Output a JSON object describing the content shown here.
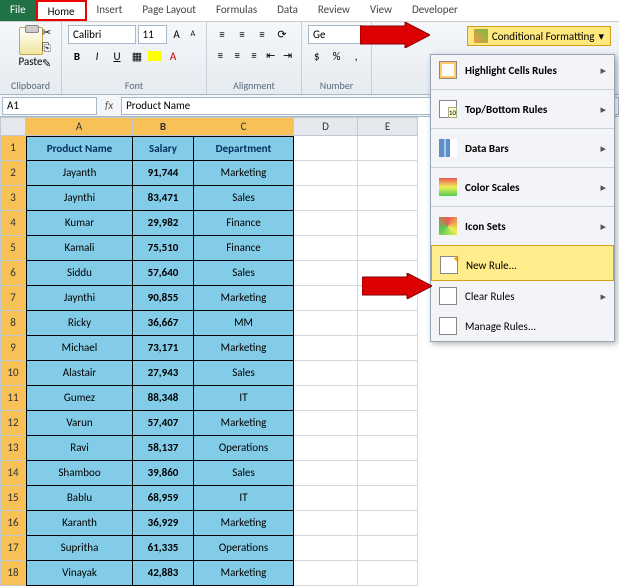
{
  "tabs": {
    "file": "File",
    "home": "Home",
    "insert": "Insert",
    "pagelayout": "Page Layout",
    "formulas": "Formulas",
    "data": "Data",
    "review": "Review",
    "view": "View",
    "developer": "Developer"
  },
  "ribbon": {
    "paste": "Paste",
    "clipboard_label": "Clipboard",
    "font_name": "Calibri",
    "font_size": "11",
    "font_label": "Font",
    "align_label": "Alignment",
    "num_format": "Ge",
    "number_label": "Number",
    "cf_label": "Conditional Formatting"
  },
  "namebox": "A1",
  "fx": "fx",
  "formula": "Product Name",
  "cols": {
    "a": "A",
    "b": "B",
    "c": "C",
    "d": "D",
    "e": "E"
  },
  "headerRow": {
    "a": "Product Name",
    "b": "Salary",
    "c": "Department"
  },
  "chart_data": {
    "type": "table",
    "columns": [
      "Product Name",
      "Salary",
      "Department"
    ],
    "rows": [
      [
        "Jayanth",
        "91,744",
        "Marketing"
      ],
      [
        "Jaynthi",
        "83,471",
        "Sales"
      ],
      [
        "Kumar",
        "29,982",
        "Finance"
      ],
      [
        "Kamali",
        "75,510",
        "Finance"
      ],
      [
        "Siddu",
        "57,640",
        "Sales"
      ],
      [
        "Jaynthi",
        "90,855",
        "Marketing"
      ],
      [
        "Ricky",
        "36,667",
        "MM"
      ],
      [
        "Michael",
        "73,171",
        "Marketing"
      ],
      [
        "Alastair",
        "27,943",
        "Sales"
      ],
      [
        "Gumez",
        "88,348",
        "IT"
      ],
      [
        "Varun",
        "57,407",
        "Marketing"
      ],
      [
        "Ravi",
        "58,137",
        "Operations"
      ],
      [
        "Shamboo",
        "39,860",
        "Sales"
      ],
      [
        "Bablu",
        "68,959",
        "IT"
      ],
      [
        "Karanth",
        "36,929",
        "Marketing"
      ],
      [
        "Supritha",
        "61,335",
        "Operations"
      ],
      [
        "Vinayak",
        "42,883",
        "Marketing"
      ]
    ]
  },
  "rowNums": [
    "1",
    "2",
    "3",
    "4",
    "5",
    "6",
    "7",
    "8",
    "9",
    "10",
    "11",
    "12",
    "13",
    "14",
    "15",
    "16",
    "17",
    "18"
  ],
  "dropdown": {
    "highlight": "Highlight Cells Rules",
    "topbot": "Top/Bottom Rules",
    "databars": "Data Bars",
    "colorscales": "Color Scales",
    "iconsets": "Icon Sets",
    "newrule": "New Rule...",
    "clear": "Clear Rules",
    "manage": "Manage Rules..."
  },
  "u": {
    "u": "U",
    "underline_label": "Underline"
  },
  "accent": "#e00",
  "highlight": "#ffec8b"
}
